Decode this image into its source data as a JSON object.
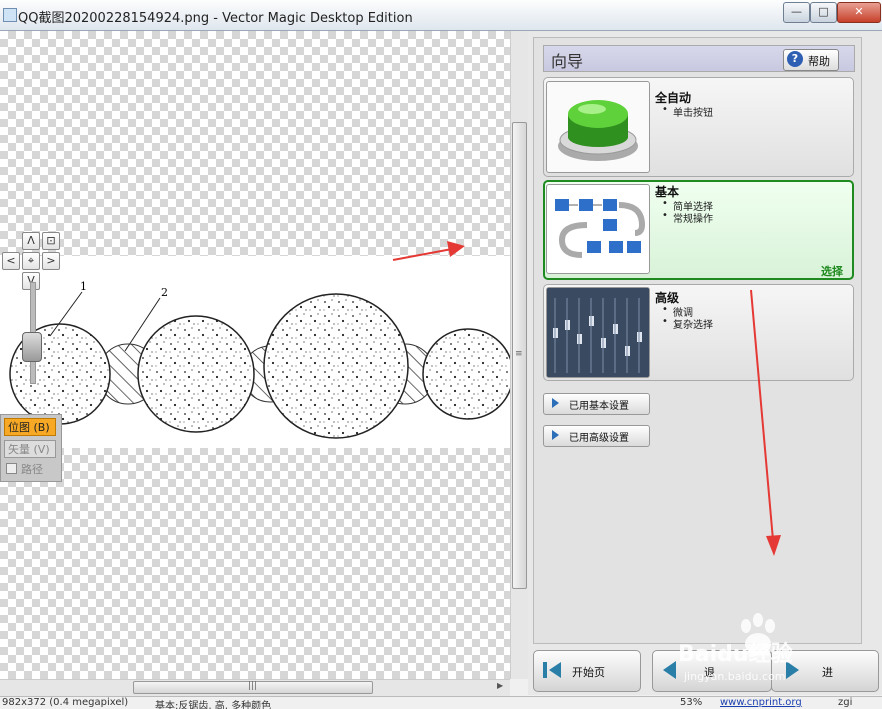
{
  "window": {
    "title": "QQ截图20200228154924.png - Vector Magic Desktop Edition",
    "min_glyph": "—",
    "max_glyph": "□",
    "close_glyph": "✕"
  },
  "canvas": {
    "nav": {
      "up": "Λ",
      "down": "V",
      "left": "<",
      "right": ">",
      "center": "⌖",
      "fit": "⊡"
    },
    "drawing_labels": [
      "1",
      "2"
    ],
    "view": {
      "bitmap_label": "位图 (B)",
      "vector_label": "矢量 (V)",
      "path_label": "路径"
    }
  },
  "wizard": {
    "title": "向导",
    "help_label": "帮助",
    "help_icon_glyph": "?",
    "cards": [
      {
        "title": "全自动",
        "bullets": [
          "单击按钮"
        ]
      },
      {
        "title": "基本",
        "bullets": [
          "简单选择",
          "常规操作"
        ],
        "selected_label": "选择"
      },
      {
        "title": "高级",
        "bullets": [
          "微调",
          "复杂选择"
        ]
      }
    ],
    "settings_buttons": [
      "已用基本设置",
      "已用高级设置"
    ]
  },
  "nav_buttons": {
    "start": "开始页",
    "back": "退",
    "next": "进"
  },
  "status": {
    "image_info": "982x372 (0.4 megapixel)",
    "mode_info": "基本:反锯齿, 高, 多种颜色",
    "zoom": "53%",
    "link": "www.cnprint.org",
    "extra": "zgi"
  },
  "watermark": {
    "brand": "Baidu经验",
    "url": "jingyan.baidu.com"
  },
  "colors": {
    "accent_orange": "#f7a824",
    "select_green": "#1f8a1f",
    "annotation_red": "#e53935",
    "help_blue": "#2f5fb3"
  }
}
